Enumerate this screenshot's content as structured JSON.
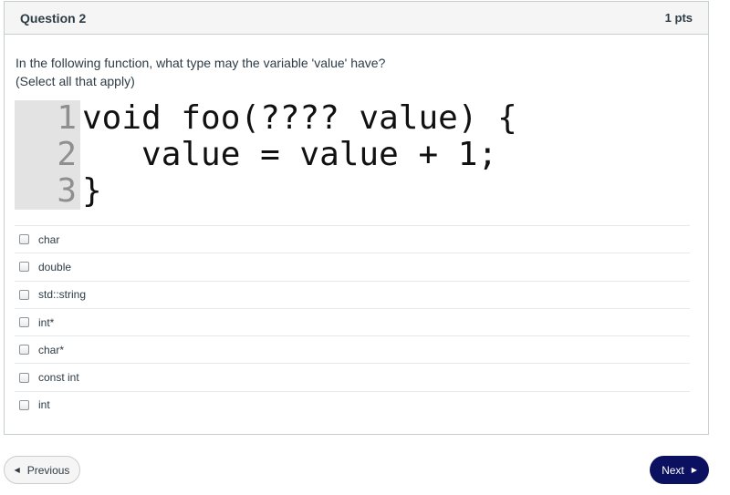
{
  "question": {
    "title": "Question 2",
    "points": "1 pts",
    "text_line1": "In the following function, what type may the variable 'value' have?",
    "text_line2": "(Select all that apply)"
  },
  "code": {
    "line_numbers": [
      "1",
      "2",
      "3"
    ],
    "lines": [
      "void foo(???? value) {",
      "   value = value + 1;",
      "}"
    ]
  },
  "answers": [
    {
      "label": "char",
      "checked": false
    },
    {
      "label": "double",
      "checked": false
    },
    {
      "label": "std::string",
      "checked": false
    },
    {
      "label": "int*",
      "checked": false
    },
    {
      "label": "char*",
      "checked": false
    },
    {
      "label": "const int",
      "checked": false
    },
    {
      "label": "int",
      "checked": false
    }
  ],
  "navigation": {
    "previous_label": "Previous",
    "next_label": "Next",
    "previous_icon": "triangle-left-icon",
    "next_icon": "triangle-right-icon"
  },
  "colors": {
    "next_button_bg": "#0b1060",
    "header_bg": "#f5f5f5",
    "text": "#2d3b45",
    "code_gutter_bg": "#e3e3e3"
  }
}
